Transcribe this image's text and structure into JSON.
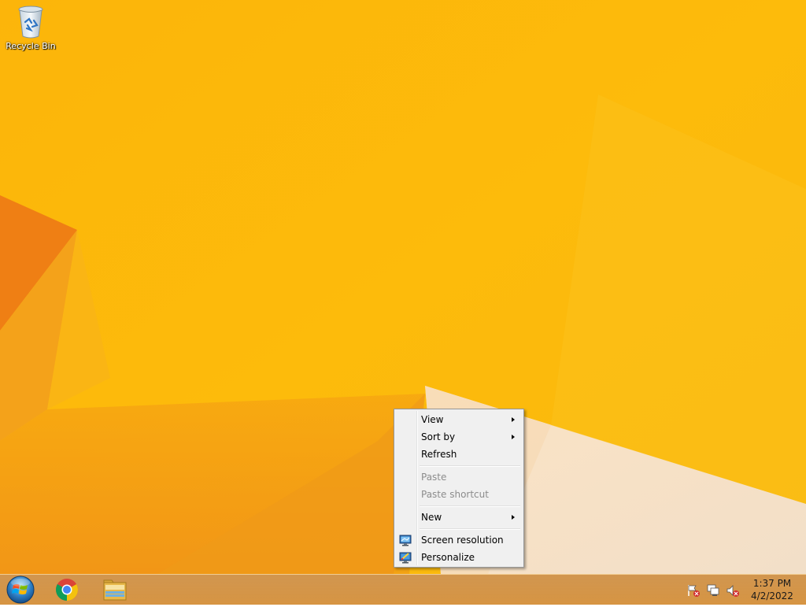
{
  "desktop": {
    "icons": [
      {
        "label": "Recycle Bin",
        "icon": "recycle-bin-icon"
      }
    ],
    "background_color": "#fdb80a"
  },
  "context_menu": {
    "items": [
      {
        "label": "View",
        "submenu": true,
        "disabled": false
      },
      {
        "label": "Sort by",
        "submenu": true,
        "disabled": false
      },
      {
        "label": "Refresh",
        "submenu": false,
        "disabled": false
      },
      {
        "label": "Paste",
        "submenu": false,
        "disabled": true
      },
      {
        "label": "Paste shortcut",
        "submenu": false,
        "disabled": true
      },
      {
        "label": "New",
        "submenu": true,
        "disabled": false
      },
      {
        "label": "Screen resolution",
        "icon": "monitor-icon",
        "disabled": false
      },
      {
        "label": "Personalize",
        "icon": "personalize-icon",
        "disabled": false
      }
    ]
  },
  "taskbar": {
    "start_icon": "windows-start-orb-icon",
    "pinned_apps": [
      {
        "name": "chrome",
        "icon": "chrome-icon"
      },
      {
        "name": "file-explorer",
        "icon": "file-explorer-icon"
      }
    ],
    "tray_icons": [
      "action-center-flag-icon",
      "network-icon",
      "volume-muted-icon"
    ],
    "clock": {
      "time": "1:37 PM",
      "date": "4/2/2022"
    }
  }
}
